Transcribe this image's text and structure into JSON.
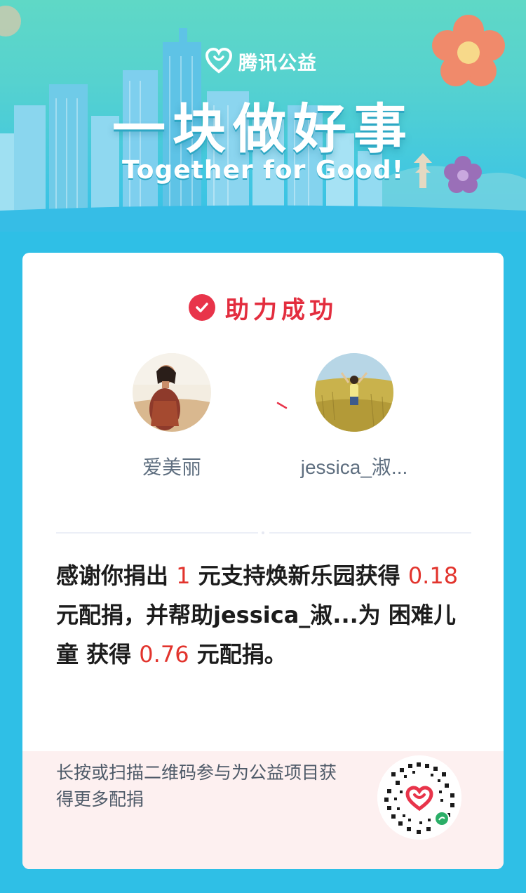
{
  "banner": {
    "brand_name": "腾讯公益",
    "slogan_cn": "一块做好事",
    "slogan_en": "Together for Good!"
  },
  "card": {
    "status": "助力成功",
    "donor_name": "爱美丽",
    "recipient_name": "jessica_淑...",
    "message": {
      "p1": "感谢你捐出 ",
      "amount1": "1",
      "p2": " 元支持焕新乐园获得 ",
      "amount2": "0.18",
      "p3": " 元配捐，并帮助jessica_淑...为 困难儿童 获得 ",
      "amount3": "0.76",
      "p4": " 元配捐。"
    }
  },
  "footer": {
    "hint": "长按或扫描二维码参与为公益项目获得更多配捐"
  },
  "colors": {
    "accent_red": "#e2342d",
    "banner_teal": "#56d2cf",
    "page_blue": "#2fbfe6"
  }
}
